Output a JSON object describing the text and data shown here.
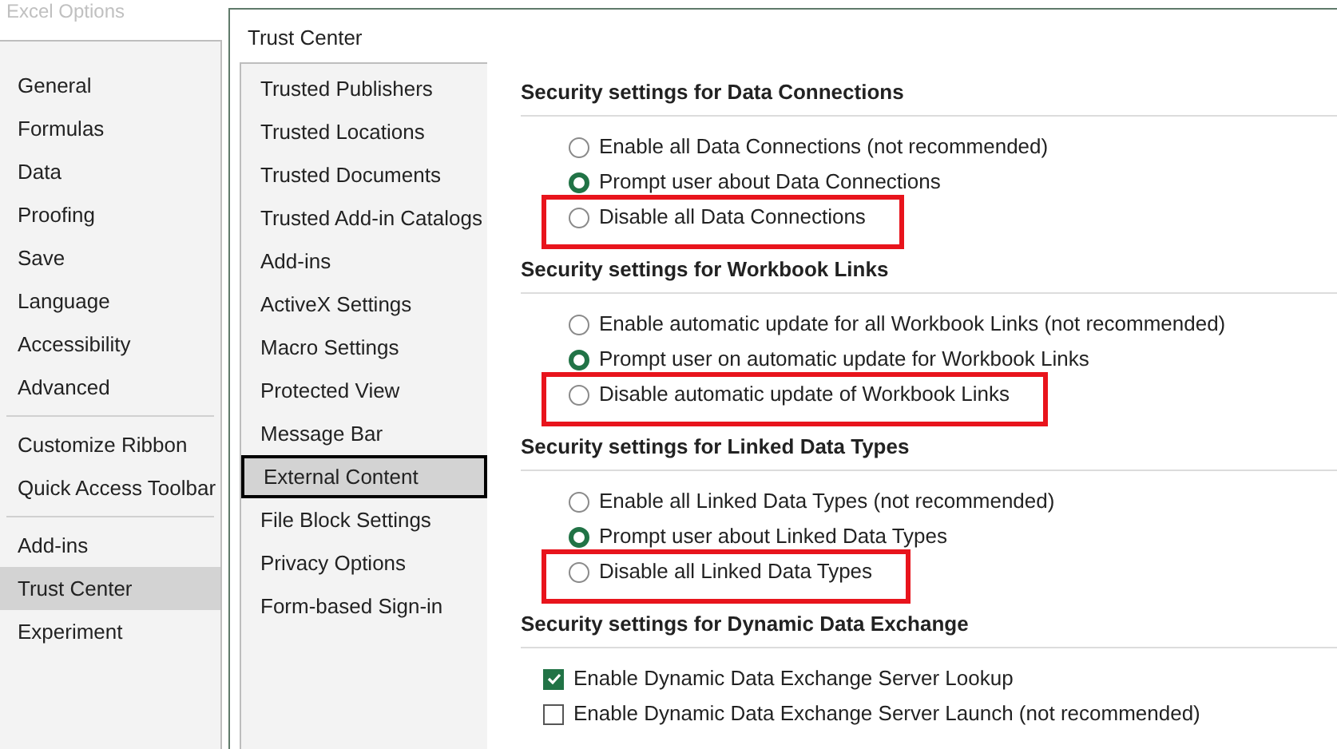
{
  "options_window": {
    "title": "Excel Options",
    "items": [
      {
        "label": "General",
        "selected": false,
        "separator_after": false
      },
      {
        "label": "Formulas",
        "selected": false,
        "separator_after": false
      },
      {
        "label": "Data",
        "selected": false,
        "separator_after": false
      },
      {
        "label": "Proofing",
        "selected": false,
        "separator_after": false
      },
      {
        "label": "Save",
        "selected": false,
        "separator_after": false
      },
      {
        "label": "Language",
        "selected": false,
        "separator_after": false
      },
      {
        "label": "Accessibility",
        "selected": false,
        "separator_after": false
      },
      {
        "label": "Advanced",
        "selected": false,
        "separator_after": true
      },
      {
        "label": "Customize Ribbon",
        "selected": false,
        "separator_after": false
      },
      {
        "label": "Quick Access Toolbar",
        "selected": false,
        "separator_after": true
      },
      {
        "label": "Add-ins",
        "selected": false,
        "separator_after": false
      },
      {
        "label": "Trust Center",
        "selected": true,
        "separator_after": false
      },
      {
        "label": "Experiment",
        "selected": false,
        "separator_after": false
      }
    ]
  },
  "trust_center": {
    "title": "Trust Center",
    "nav": [
      {
        "label": "Trusted Publishers",
        "selected": false
      },
      {
        "label": "Trusted Locations",
        "selected": false
      },
      {
        "label": "Trusted Documents",
        "selected": false
      },
      {
        "label": "Trusted Add-in Catalogs",
        "selected": false
      },
      {
        "label": "Add-ins",
        "selected": false
      },
      {
        "label": "ActiveX Settings",
        "selected": false
      },
      {
        "label": "Macro Settings",
        "selected": false
      },
      {
        "label": "Protected View",
        "selected": false
      },
      {
        "label": "Message Bar",
        "selected": false
      },
      {
        "label": "External Content",
        "selected": true
      },
      {
        "label": "File Block Settings",
        "selected": false
      },
      {
        "label": "Privacy Options",
        "selected": false
      },
      {
        "label": "Form-based Sign-in",
        "selected": false
      }
    ],
    "sections": [
      {
        "heading": "Security settings for Data Connections",
        "options": [
          {
            "kind": "radio",
            "label": "Enable all Data Connections (not recommended)",
            "selected": false,
            "highlighted": false
          },
          {
            "kind": "radio",
            "label": "Prompt user about Data Connections",
            "selected": true,
            "highlighted": false
          },
          {
            "kind": "radio",
            "label": "Disable all Data Connections",
            "selected": false,
            "highlighted": true
          }
        ]
      },
      {
        "heading": "Security settings for Workbook Links",
        "options": [
          {
            "kind": "radio",
            "label": "Enable automatic update for all Workbook Links (not recommended)",
            "selected": false,
            "highlighted": false
          },
          {
            "kind": "radio",
            "label": "Prompt user on automatic update for Workbook Links",
            "selected": true,
            "highlighted": false
          },
          {
            "kind": "radio",
            "label": "Disable automatic update of Workbook Links",
            "selected": false,
            "highlighted": true
          }
        ]
      },
      {
        "heading": "Security settings for Linked Data Types",
        "options": [
          {
            "kind": "radio",
            "label": "Enable all Linked Data Types (not recommended)",
            "selected": false,
            "highlighted": false
          },
          {
            "kind": "radio",
            "label": "Prompt user about Linked Data Types",
            "selected": true,
            "highlighted": false
          },
          {
            "kind": "radio",
            "label": "Disable all Linked Data Types",
            "selected": false,
            "highlighted": true
          }
        ]
      },
      {
        "heading": "Security settings for Dynamic Data Exchange",
        "options": [
          {
            "kind": "checkbox",
            "label": "Enable Dynamic Data Exchange Server Lookup",
            "checked": true,
            "highlighted": false
          },
          {
            "kind": "checkbox",
            "label": "Enable Dynamic Data Exchange Server Launch (not recommended)",
            "checked": false,
            "highlighted": false
          }
        ]
      }
    ]
  }
}
